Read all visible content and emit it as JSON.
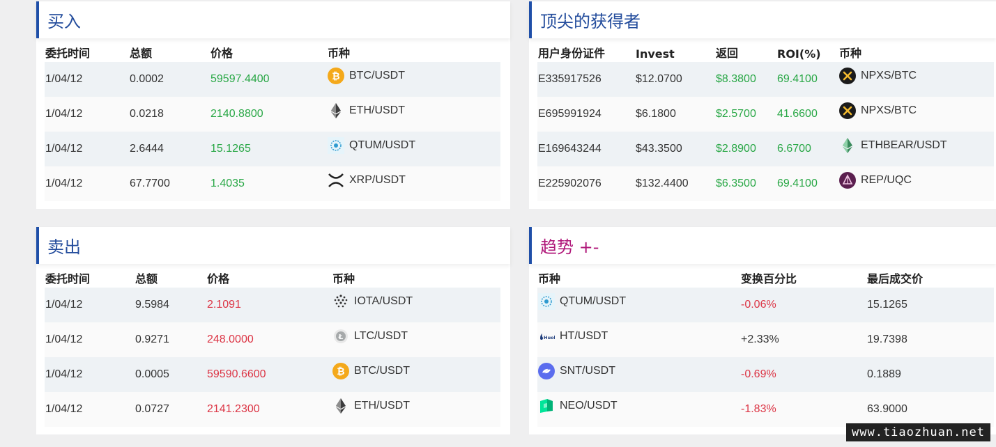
{
  "buy": {
    "title": "买入",
    "headers": [
      "委托时间",
      "总额",
      "价格",
      "币种"
    ],
    "rows": [
      {
        "time": "1/04/12",
        "amount": "0.0002",
        "price": "59597.4400",
        "pair": "BTC/USDT"
      },
      {
        "time": "1/04/12",
        "amount": "0.0218",
        "price": "2140.8800",
        "pair": "ETH/USDT"
      },
      {
        "time": "1/04/12",
        "amount": "2.6444",
        "price": "15.1265",
        "pair": "QTUM/USDT"
      },
      {
        "time": "1/04/12",
        "amount": "67.7700",
        "price": "1.4035",
        "pair": "XRP/USDT"
      }
    ]
  },
  "sell": {
    "title": "卖出",
    "headers": [
      "委托时间",
      "总额",
      "价格",
      "币种"
    ],
    "rows": [
      {
        "time": "1/04/12",
        "amount": "9.5984",
        "price": "2.1091",
        "pair": "IOTA/USDT"
      },
      {
        "time": "1/04/12",
        "amount": "0.9271",
        "price": "248.0000",
        "pair": "LTC/USDT"
      },
      {
        "time": "1/04/12",
        "amount": "0.0005",
        "price": "59590.6600",
        "pair": "BTC/USDT"
      },
      {
        "time": "1/04/12",
        "amount": "0.0727",
        "price": "2141.2300",
        "pair": "ETH/USDT"
      }
    ]
  },
  "top": {
    "title": "顶尖的获得者",
    "headers": [
      "用户身份证件",
      "Invest",
      "返回",
      "ROI(%)",
      "币种"
    ],
    "rows": [
      {
        "id": "E335917526",
        "invest": "$12.0700",
        "ret": "$8.3800",
        "roi": "69.4100",
        "pair": "NPXS/BTC"
      },
      {
        "id": "E695991924",
        "invest": "$6.1800",
        "ret": "$2.5700",
        "roi": "41.6600",
        "pair": "NPXS/BTC"
      },
      {
        "id": "E169643244",
        "invest": "$43.3500",
        "ret": "$2.8900",
        "roi": "6.6700",
        "pair": "ETHBEAR/USDT"
      },
      {
        "id": "E225902076",
        "invest": "$132.4400",
        "ret": "$6.3500",
        "roi": "69.4100",
        "pair": "REP/UQC"
      }
    ]
  },
  "trend": {
    "title": "趋势 +-",
    "headers": [
      "币种",
      "变换百分比",
      "最后成交价"
    ],
    "rows": [
      {
        "pair": "QTUM/USDT",
        "change": "-0.06%",
        "last": "15.1265"
      },
      {
        "pair": "HT/USDT",
        "change": "+2.33%",
        "last": "19.7398"
      },
      {
        "pair": "SNT/USDT",
        "change": "-0.69%",
        "last": "0.1889"
      },
      {
        "pair": "NEO/USDT",
        "change": "-1.83%",
        "last": "63.9000"
      }
    ]
  },
  "watermark": "www.tiaozhuan.net",
  "colors": {
    "accent": "#1f4fa8",
    "title": "#234c9c",
    "trend_title": "#b0187a",
    "positive": "#28a745",
    "negative": "#dc3545"
  }
}
